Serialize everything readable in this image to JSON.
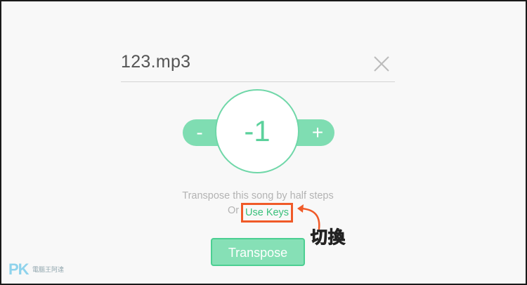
{
  "file": {
    "name": "123.mp3",
    "clear_icon": "close-icon"
  },
  "stepper": {
    "decrement_label": "-",
    "value": "-1",
    "increment_label": "+"
  },
  "hint": {
    "line1": "Transpose this song by half steps",
    "or_text": "Or",
    "use_keys_label": "Use Keys"
  },
  "annotation": {
    "label": "切換",
    "arrow_icon": "curved-arrow-icon"
  },
  "actions": {
    "transpose_label": "Transpose"
  },
  "watermark": {
    "logo": "PK",
    "sub": "電腦王阿達"
  },
  "colors": {
    "accent": "#7fddb2",
    "accent_text": "#5cd19c",
    "link": "#39c07b",
    "highlight": "#f05a28",
    "muted_text": "#b3b3b3"
  }
}
